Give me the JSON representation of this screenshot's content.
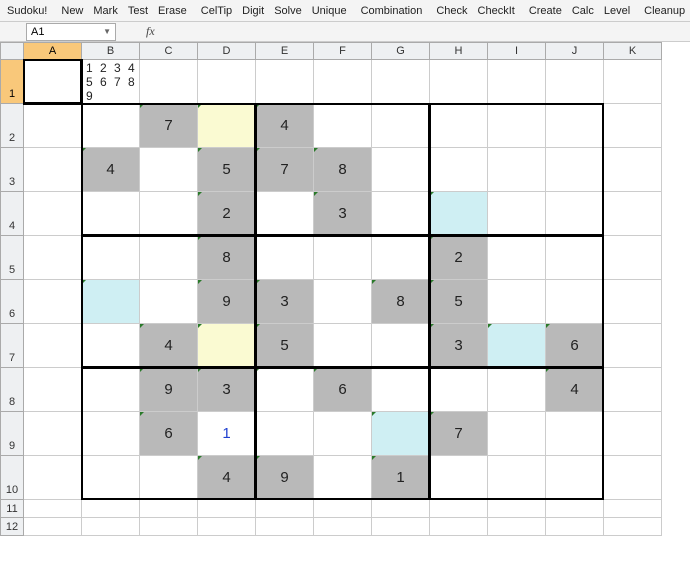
{
  "menu": {
    "title": "Sudoku!",
    "groups": [
      [
        "New",
        "Mark",
        "Test",
        "Erase"
      ],
      [
        "CelTip",
        "Digit",
        "Solve",
        "Unique"
      ],
      [
        "Combination"
      ],
      [
        "Check",
        "CheckIt"
      ],
      [
        "Create",
        "Calc",
        "Level"
      ],
      [
        "Cleanup"
      ]
    ]
  },
  "nameBox": "A1",
  "fxLabel": "fx",
  "columns": [
    "A",
    "B",
    "C",
    "D",
    "E",
    "F",
    "G",
    "H",
    "I",
    "J",
    "K"
  ],
  "rowLabels": [
    "1",
    "2",
    "3",
    "4",
    "5",
    "6",
    "7",
    "8",
    "9",
    "10",
    "11",
    "12"
  ],
  "activeCell": {
    "col": "A",
    "row": 1
  },
  "row1Text": "1 2 3 4 5 6 7 8 9",
  "sudoku": {
    "rows": [
      [
        {
          "v": "",
          "s": ""
        },
        {
          "v": "7",
          "s": "gray notch"
        },
        {
          "v": "",
          "s": "yellow notch"
        },
        {
          "v": "4",
          "s": "gray notch"
        },
        {
          "v": "",
          "s": ""
        },
        {
          "v": "",
          "s": ""
        },
        {
          "v": "",
          "s": ""
        },
        {
          "v": "",
          "s": ""
        },
        {
          "v": "",
          "s": ""
        }
      ],
      [
        {
          "v": "4",
          "s": "gray notch"
        },
        {
          "v": "",
          "s": ""
        },
        {
          "v": "5",
          "s": "gray notch"
        },
        {
          "v": "7",
          "s": "gray notch"
        },
        {
          "v": "8",
          "s": "gray notch"
        },
        {
          "v": "",
          "s": ""
        },
        {
          "v": "",
          "s": ""
        },
        {
          "v": "",
          "s": ""
        },
        {
          "v": "",
          "s": ""
        }
      ],
      [
        {
          "v": "",
          "s": ""
        },
        {
          "v": "",
          "s": ""
        },
        {
          "v": "2",
          "s": "gray notch"
        },
        {
          "v": "",
          "s": ""
        },
        {
          "v": "3",
          "s": "gray notch"
        },
        {
          "v": "",
          "s": ""
        },
        {
          "v": "",
          "s": "cyan notch"
        },
        {
          "v": "",
          "s": ""
        },
        {
          "v": "",
          "s": ""
        }
      ],
      [
        {
          "v": "",
          "s": ""
        },
        {
          "v": "",
          "s": ""
        },
        {
          "v": "8",
          "s": "gray notch"
        },
        {
          "v": "",
          "s": ""
        },
        {
          "v": "",
          "s": ""
        },
        {
          "v": "",
          "s": ""
        },
        {
          "v": "2",
          "s": "gray notch"
        },
        {
          "v": "",
          "s": ""
        },
        {
          "v": "",
          "s": ""
        }
      ],
      [
        {
          "v": "",
          "s": "cyan notch"
        },
        {
          "v": "",
          "s": ""
        },
        {
          "v": "9",
          "s": "gray notch"
        },
        {
          "v": "3",
          "s": "gray notch"
        },
        {
          "v": "",
          "s": ""
        },
        {
          "v": "8",
          "s": "gray notch"
        },
        {
          "v": "5",
          "s": "gray notch"
        },
        {
          "v": "",
          "s": ""
        },
        {
          "v": "",
          "s": ""
        }
      ],
      [
        {
          "v": "",
          "s": ""
        },
        {
          "v": "4",
          "s": "gray notch"
        },
        {
          "v": "",
          "s": "yellow notch"
        },
        {
          "v": "5",
          "s": "gray notch"
        },
        {
          "v": "",
          "s": ""
        },
        {
          "v": "",
          "s": ""
        },
        {
          "v": "3",
          "s": "gray notch"
        },
        {
          "v": "",
          "s": "cyan notch"
        },
        {
          "v": "6",
          "s": "gray notch"
        }
      ],
      [
        {
          "v": "",
          "s": ""
        },
        {
          "v": "9",
          "s": "gray notch"
        },
        {
          "v": "3",
          "s": "gray notch"
        },
        {
          "v": "",
          "s": "notch"
        },
        {
          "v": "6",
          "s": "gray notch"
        },
        {
          "v": "",
          "s": ""
        },
        {
          "v": "",
          "s": ""
        },
        {
          "v": "",
          "s": ""
        },
        {
          "v": "4",
          "s": "gray notch"
        }
      ],
      [
        {
          "v": "",
          "s": ""
        },
        {
          "v": "6",
          "s": "gray notch"
        },
        {
          "v": "1",
          "s": "blue-text"
        },
        {
          "v": "",
          "s": ""
        },
        {
          "v": "",
          "s": ""
        },
        {
          "v": "",
          "s": "cyan notch"
        },
        {
          "v": "7",
          "s": "gray notch"
        },
        {
          "v": "",
          "s": ""
        },
        {
          "v": "",
          "s": ""
        }
      ],
      [
        {
          "v": "",
          "s": ""
        },
        {
          "v": "",
          "s": ""
        },
        {
          "v": "4",
          "s": "gray notch"
        },
        {
          "v": "9",
          "s": "gray notch"
        },
        {
          "v": "",
          "s": ""
        },
        {
          "v": "1",
          "s": "gray notch"
        },
        {
          "v": "",
          "s": ""
        },
        {
          "v": "",
          "s": ""
        },
        {
          "v": "",
          "s": ""
        }
      ]
    ]
  }
}
